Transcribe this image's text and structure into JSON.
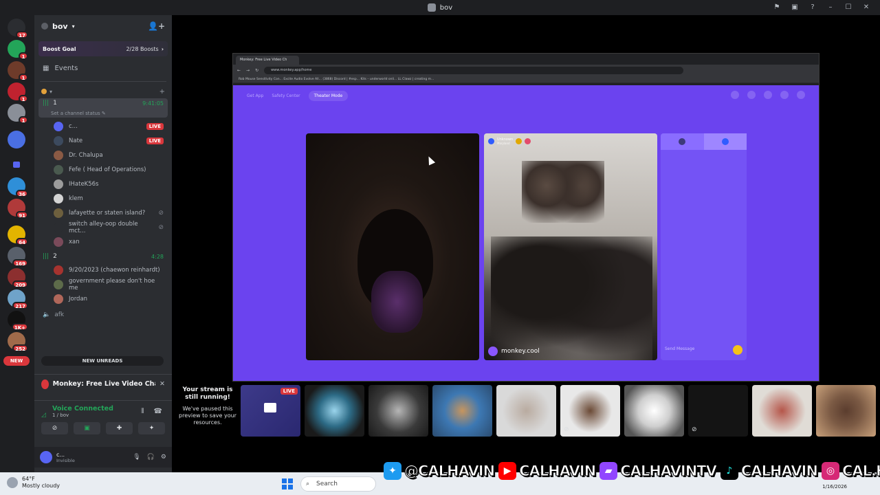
{
  "window": {
    "title": "bov"
  },
  "rail": {
    "badges": [
      "17",
      "1",
      "1",
      "1",
      "1",
      "36",
      "91",
      "64",
      "169",
      "209",
      "217",
      "1K+",
      "252"
    ],
    "new_label": "NEW"
  },
  "server": {
    "name": "bov",
    "boost_goal": "Boost Goal",
    "boost_count": "2/28 Boosts",
    "events": "Events"
  },
  "voice1": {
    "name": "1",
    "time": "9:41:05",
    "status": "Set a channel status",
    "members": [
      {
        "name": "c...",
        "live": "LIVE"
      },
      {
        "name": "Nate",
        "live": "LIVE"
      },
      {
        "name": "Dr. Chalupa"
      },
      {
        "name": "Fefe ( Head of Operations)"
      },
      {
        "name": "IHateK56s"
      },
      {
        "name": "klem"
      },
      {
        "name": "lafayette or staten island?"
      },
      {
        "name": "switch alley-oop double mct..."
      },
      {
        "name": "xan"
      }
    ]
  },
  "voice2": {
    "name": "2",
    "time": "4:28",
    "members": [
      {
        "name": "9/20/2023 (chaewon reinhardt)"
      },
      {
        "name": "government please don't hoe me"
      },
      {
        "name": "Jordan"
      }
    ]
  },
  "afk": "afk",
  "new_unreads": "NEW UNREADS",
  "now_playing": "Monkey: Free Live Video Chat to M...",
  "voice_status": {
    "title": "Voice Connected",
    "sub": "1 / bov"
  },
  "user": {
    "name": "c...",
    "status": "Invisible"
  },
  "browser": {
    "tab": "Monkey: Free Live Video Ch",
    "url": "www.monkey.app/home",
    "bookmarks": "Rob   Mouse Sensitivity Con...   Excite Audio Evolve All...   (3868) Discord | #esp...   Kits – underworld onli...   LL Clawz | creating m...",
    "get_app": "Get App",
    "safety": "Safety Center",
    "theater": "Theater Mode",
    "unknown": "Unknown",
    "unknown_sub": "Maryland",
    "watermark": "monkey.cool",
    "send_placeholder": "Send Message"
  },
  "stream": {
    "title": "Your stream is still running!",
    "sub": "We've paused this preview to save your resources.",
    "live": "LIVE"
  },
  "taskbar": {
    "temp": "64°F",
    "weather": "Mostly cloudy",
    "search": "Search",
    "date": "1/16/2026"
  },
  "socials": [
    {
      "icon": "twitter-icon",
      "handle": "@CALHAVIN",
      "color": "#1d9bf0"
    },
    {
      "icon": "youtube-icon",
      "handle": "CALHAVIN",
      "color": "#ff0000"
    },
    {
      "icon": "twitch-icon",
      "handle": "CALHAVINTV",
      "color": "#9146ff"
    },
    {
      "icon": "tiktok-icon",
      "handle": "CALHAVIN",
      "color": "#000000"
    },
    {
      "icon": "instagram-icon",
      "handle": "CAL.HAVIN",
      "color": "#d62976"
    }
  ]
}
